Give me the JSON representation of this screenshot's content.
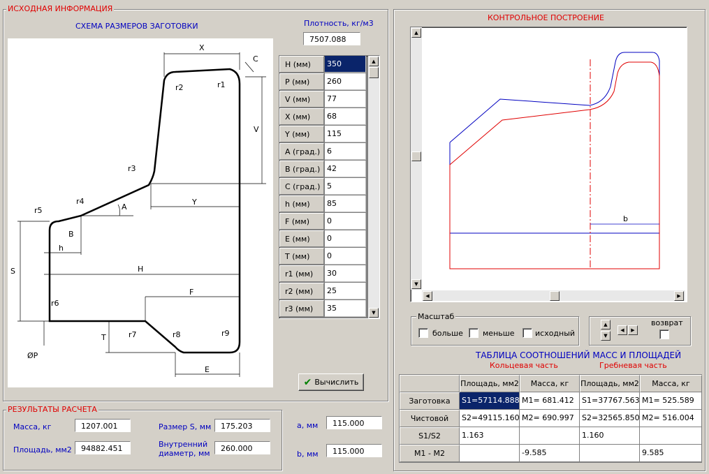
{
  "groups": {
    "input": "ИСХОДНАЯ ИНФОРМАЦИЯ",
    "control": "КОНТРОЛЬНОЕ ПОСТРОЕНИЕ",
    "results": "РЕЗУЛЬТАТЫ РАСЧЕТА"
  },
  "scheme_title": "СХЕМА РАЗМЕРОВ ЗАГОТОВКИ",
  "density": {
    "label": "Плотность, кг/м3",
    "value": "7507.088"
  },
  "params": [
    {
      "name": "H (мм)",
      "value": "350"
    },
    {
      "name": "P (мм)",
      "value": "260"
    },
    {
      "name": "V (мм)",
      "value": "77"
    },
    {
      "name": "X (мм)",
      "value": "68"
    },
    {
      "name": "Y (мм)",
      "value": "115"
    },
    {
      "name": "A (град.)",
      "value": "6"
    },
    {
      "name": "B (град.)",
      "value": "42"
    },
    {
      "name": "C (град.)",
      "value": "5"
    },
    {
      "name": "h (мм)",
      "value": "85"
    },
    {
      "name": "F (мм)",
      "value": "0"
    },
    {
      "name": "E (мм)",
      "value": "0"
    },
    {
      "name": "T (мм)",
      "value": "0"
    },
    {
      "name": "r1 (мм)",
      "value": "30"
    },
    {
      "name": "r2 (мм)",
      "value": "25"
    },
    {
      "name": "r3 (мм)",
      "value": "35"
    }
  ],
  "calc_button": "Вычислить",
  "drawing_labels": {
    "X": "X",
    "C": "C",
    "V": "V",
    "Y": "Y",
    "A": "A",
    "B": "B",
    "H": "H",
    "h": "h",
    "S": "S",
    "F": "F",
    "T": "T",
    "E": "E",
    "P": "ØP",
    "r1": "r1",
    "r2": "r2",
    "r3": "r3",
    "r4": "r4",
    "r5": "r5",
    "r6": "r6",
    "r7": "r7",
    "r8": "r8",
    "r9": "r9"
  },
  "preview_label_b": "b",
  "scale": {
    "title": "Масштаб",
    "bigger": "больше",
    "smaller": "меньше",
    "original": "исходный",
    "return": "возврат"
  },
  "table": {
    "title": "ТАБЛИЦА СООТНОШЕНИЙ МАСС И ПЛОЩАДЕЙ",
    "ring": "Кольцевая часть",
    "ridge": "Гребневая часть",
    "headers": [
      "",
      "Площадь, мм2",
      "Масса, кг",
      "Площадь, мм2",
      "Масса, кг"
    ],
    "rows": [
      [
        "Заготовка",
        "S1=57114.888",
        "M1= 681.412",
        "S1=37767.563",
        "M1= 525.589"
      ],
      [
        "Чистовой",
        "S2=49115.160",
        "M2= 690.997",
        "S2=32565.850",
        "M2= 516.004"
      ],
      [
        "S1/S2",
        "1.163",
        "",
        "1.160",
        ""
      ],
      [
        "M1 - M2",
        "",
        "-9.585",
        "",
        "9.585"
      ]
    ]
  },
  "results": {
    "mass_label": "Масса, кг",
    "mass_value": "1207.001",
    "area_label": "Площадь, мм2",
    "area_value": "94882.451",
    "size_s_label": "Размер S, мм",
    "size_s_value": "175.203",
    "inner_label_1": "Внутренний",
    "inner_label_2": "диаметр, мм",
    "inner_value": "260.000"
  },
  "ab": {
    "a_label": "a, мм",
    "a_value": "115.000",
    "b_label": "b, мм",
    "b_value": "115.000"
  },
  "colors": {
    "accent_red": "#e00000",
    "label_blue": "#0000c0",
    "selection": "#0a246a"
  }
}
